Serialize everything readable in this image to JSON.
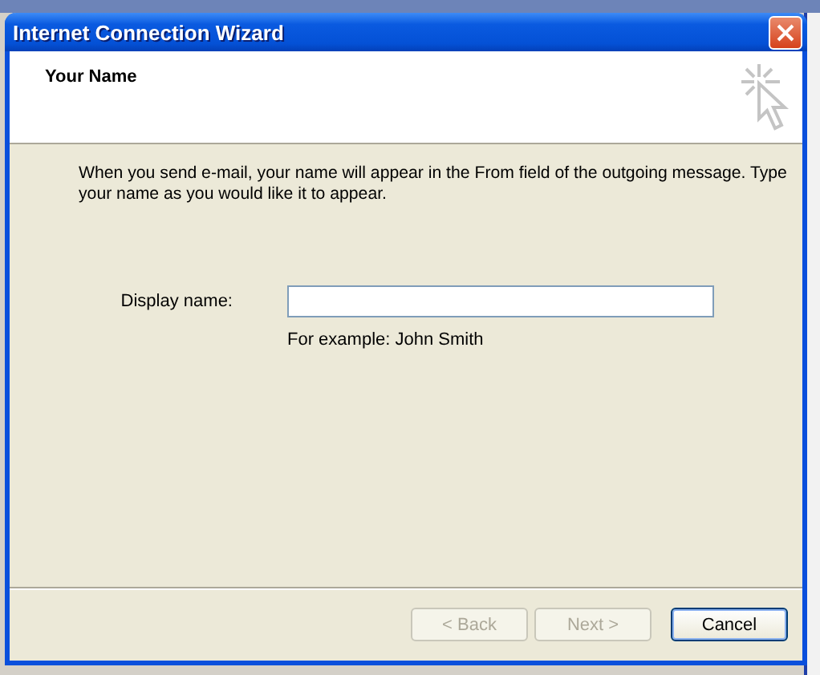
{
  "window": {
    "title": "Internet Connection Wizard"
  },
  "header": {
    "title": "Your Name"
  },
  "intro": "When you send e-mail, your name will appear in the From field of the outgoing message. Type your name as you would like it to appear.",
  "display_name": {
    "label": "Display name:"
  },
  "example": "For example: John Smith",
  "buttons": [
    {
      "label": "< Back",
      "disabled": true,
      "default": false
    },
    {
      "label": "Next >",
      "disabled": true,
      "default": false
    },
    {
      "label": "Cancel",
      "disabled": false,
      "default": true
    }
  ]
}
